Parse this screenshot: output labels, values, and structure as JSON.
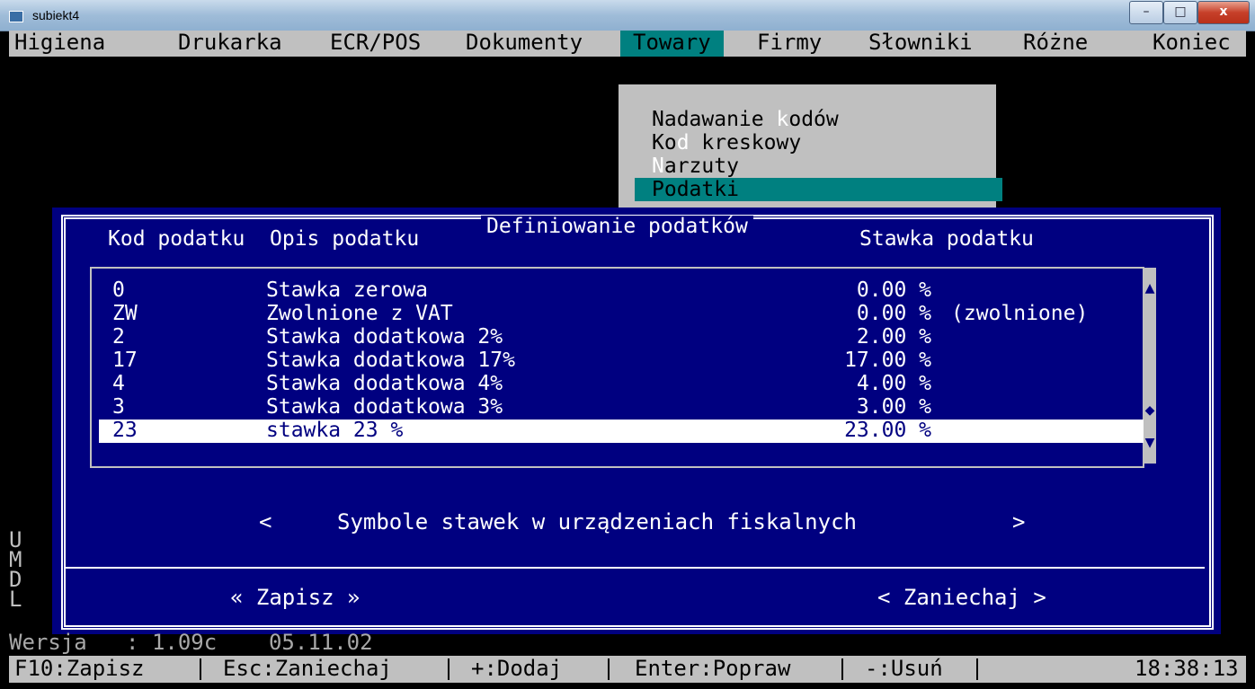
{
  "window": {
    "title": "subiekt4",
    "minimize": "–",
    "maximize": "□",
    "close": "x"
  },
  "menu": [
    "Higiena",
    "Drukarka",
    "ECR/POS",
    "Dokumenty",
    "Towary",
    "Firmy",
    "Słowniki",
    "Różne",
    "Koniec"
  ],
  "active_menu": "Towary",
  "dropdown": {
    "item1": {
      "pre": "Nadawanie ",
      "hot": "k",
      "post": "odów"
    },
    "item2": {
      "pre": "Ko",
      "hot": "d",
      "post": " kreskowy"
    },
    "item3": {
      "pre": "",
      "hot": "N",
      "post": "arzuty"
    },
    "item4": "Podatki"
  },
  "dialog": {
    "title": "Definiowanie podatków",
    "col_code": "Kod podatku",
    "col_desc": "Opis podatku",
    "col_rate": "Stawka podatku",
    "rows": [
      {
        "code": "0",
        "desc": "Stawka zerowa",
        "rate": "0.00 %",
        "note": ""
      },
      {
        "code": "ZW",
        "desc": "Zwolnione z VAT",
        "rate": "0.00 %",
        "note": "(zwolnione)"
      },
      {
        "code": "2",
        "desc": "Stawka dodatkowa 2%",
        "rate": "2.00 %",
        "note": ""
      },
      {
        "code": "17",
        "desc": "Stawka dodatkowa 17%",
        "rate": "17.00 %",
        "note": ""
      },
      {
        "code": "4",
        "desc": "Stawka dodatkowa 4%",
        "rate": "4.00 %",
        "note": ""
      },
      {
        "code": "3",
        "desc": "Stawka dodatkowa 3%",
        "rate": "3.00 %",
        "note": ""
      },
      {
        "code": "23",
        "desc": "stawka 23 %",
        "rate": "23.00 %",
        "note": ""
      }
    ],
    "fiscal_left": "<",
    "fiscal_label": "Symbole stawek w urządzeniach fiskalnych",
    "fiscal_right": ">",
    "save": "« Zapisz »",
    "cancel": "< Zaniechaj >"
  },
  "left_letters": [
    "U",
    "M",
    "D",
    "L"
  ],
  "version_line": "Wersja   : 1.09c    05.11.02",
  "status": {
    "f10": "F10:Zapisz",
    "esc": "Esc:Zaniechaj",
    "add": "+:Dodaj",
    "enter": "Enter:Popraw",
    "del": "-:Usuń",
    "clock": "18:38:13"
  },
  "colors": {
    "dialog_bg": "#000080",
    "menu_active": "#008080",
    "menu_bg": "#c0c0c0",
    "text_white": "#ffffff"
  }
}
